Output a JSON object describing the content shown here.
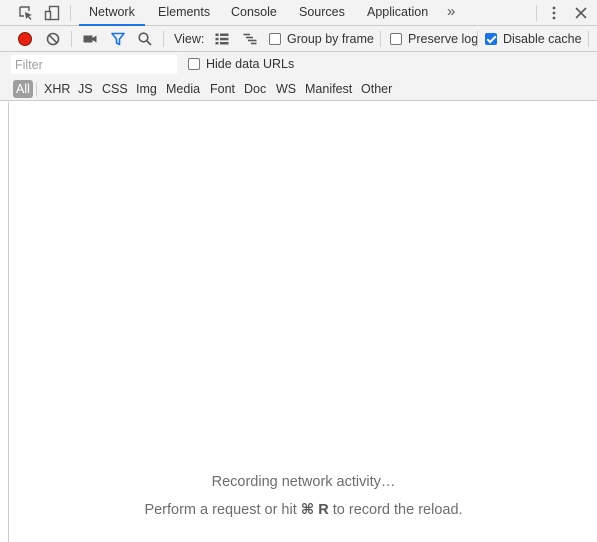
{
  "tabs": {
    "items": [
      {
        "label": "Network",
        "active": true
      },
      {
        "label": "Elements",
        "active": false
      },
      {
        "label": "Console",
        "active": false
      },
      {
        "label": "Sources",
        "active": false
      },
      {
        "label": "Application",
        "active": false
      }
    ],
    "overflow_glyph": "»"
  },
  "toolbar": {
    "view_label": "View:",
    "group_by_frame": {
      "label": "Group by frame",
      "checked": false
    },
    "preserve_log": {
      "label": "Preserve log",
      "checked": false
    },
    "disable_cache": {
      "label": "Disable cache",
      "checked": true
    }
  },
  "filter": {
    "placeholder": "Filter",
    "value": "",
    "hide_data_urls": {
      "label": "Hide data URLs",
      "checked": false
    }
  },
  "types": [
    {
      "label": "All",
      "active": true
    },
    {
      "label": "XHR",
      "active": false
    },
    {
      "label": "JS",
      "active": false
    },
    {
      "label": "CSS",
      "active": false
    },
    {
      "label": "Img",
      "active": false
    },
    {
      "label": "Media",
      "active": false
    },
    {
      "label": "Font",
      "active": false
    },
    {
      "label": "Doc",
      "active": false
    },
    {
      "label": "WS",
      "active": false
    },
    {
      "label": "Manifest",
      "active": false
    },
    {
      "label": "Other",
      "active": false
    }
  ],
  "empty_state": {
    "line1": "Recording network activity…",
    "line2_before": "Perform a request or hit ",
    "line2_shortcut": "⌘ R",
    "line2_after": " to record the reload."
  },
  "colors": {
    "record_red": "#e8210f",
    "active_blue": "#1a73e8"
  }
}
